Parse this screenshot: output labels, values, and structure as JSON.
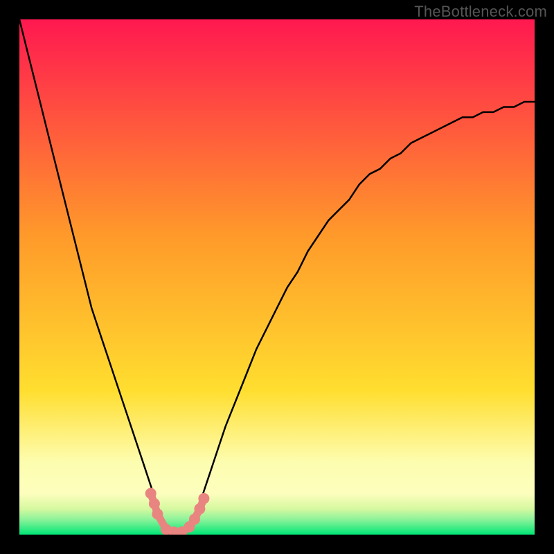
{
  "watermark": "TheBottleneck.com",
  "colors": {
    "top": "#ff1850",
    "midTop": "#ff7a2a",
    "mid": "#ffde2f",
    "lowBand": "#fdfebd",
    "green1": "#b6f98e",
    "green2": "#00e676",
    "curve": "#000000",
    "marker": "#e98580",
    "background": "#000000"
  },
  "chart_data": {
    "type": "line",
    "title": "",
    "xlabel": "",
    "ylabel": "",
    "xlim": [
      0,
      100
    ],
    "ylim": [
      0,
      100
    ],
    "x": [
      0,
      2,
      4,
      6,
      8,
      10,
      12,
      14,
      16,
      18,
      20,
      22,
      24,
      26,
      27,
      27.5,
      28,
      29,
      30,
      31,
      32,
      33,
      34,
      35,
      36,
      37,
      38,
      40,
      42,
      44,
      46,
      48,
      50,
      52,
      54,
      56,
      58,
      60,
      62,
      64,
      66,
      68,
      70,
      72,
      74,
      76,
      78,
      80,
      82,
      84,
      86,
      88,
      90,
      92,
      94,
      96,
      98,
      100
    ],
    "series": [
      {
        "name": "bottleneck-curve",
        "values": [
          100,
          92,
          84,
          76,
          68,
          60,
          52,
          44,
          38,
          32,
          26,
          20,
          14,
          8,
          5,
          3,
          1,
          0,
          0,
          0,
          1,
          2,
          4,
          6,
          9,
          12,
          15,
          21,
          26,
          31,
          36,
          40,
          44,
          48,
          51,
          55,
          58,
          61,
          63,
          65,
          68,
          70,
          71,
          73,
          74,
          76,
          77,
          78,
          79,
          80,
          81,
          81,
          82,
          82,
          83,
          83,
          84,
          84
        ]
      }
    ],
    "markers": {
      "name": "highlighted-points",
      "points": [
        {
          "x": 25.5,
          "y": 8
        },
        {
          "x": 26.2,
          "y": 6
        },
        {
          "x": 26.8,
          "y": 4
        },
        {
          "x": 28.5,
          "y": 1
        },
        {
          "x": 30.0,
          "y": 0.5
        },
        {
          "x": 31.5,
          "y": 0.5
        },
        {
          "x": 33.0,
          "y": 1.5
        },
        {
          "x": 34.0,
          "y": 3
        },
        {
          "x": 35.0,
          "y": 5
        },
        {
          "x": 35.8,
          "y": 7
        }
      ]
    }
  }
}
